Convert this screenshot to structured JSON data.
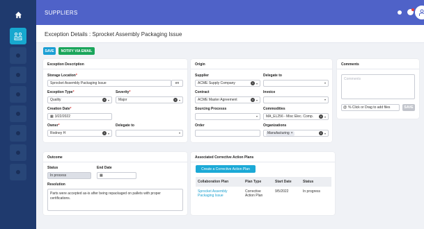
{
  "header": {
    "module_title": "SUPPLIERS"
  },
  "subheader": {
    "page_title": "Exception Details : Sprocket Assembly Packaging Issue"
  },
  "toolbar": {
    "save_label": "SAVE",
    "notify_label": "NOTIFY VIA EMAIL"
  },
  "exception_description": {
    "heading": "Exception Description",
    "storage_location_label": "Storage Location",
    "storage_location_value": "Sprocket Assembly Packaging Issue",
    "language_code": "en",
    "exception_type_label": "Exception Type",
    "exception_type_value": "Quality",
    "severity_label": "Severity",
    "severity_value": "Major",
    "creation_date_label": "Creation Date",
    "creation_date_value": "3/22/2022",
    "owner_label": "Owner",
    "owner_value": "Rodney H",
    "delegate_label": "Delegate to",
    "delegate_value": ""
  },
  "origin": {
    "heading": "Origin",
    "supplier_label": "Supplier",
    "supplier_value": "ACME Supply Company",
    "delegate_label": "Delegate to",
    "delegate_value": "",
    "contract_label": "Contract",
    "contract_value": "ACME Master Agreement",
    "invoice_label": "Invoice",
    "invoice_value": "",
    "sourcing_label": "Sourcing Processs",
    "sourcing_value": "",
    "commodities_label": "Commodities",
    "commodities_value": "MA_EL256 - Misc Elec. Comp.",
    "order_label": "Order",
    "order_value": "",
    "organizations_label": "Organizations",
    "organizations_tag": "Manufacturing"
  },
  "comments": {
    "heading": "Comments",
    "placeholder": "Comments",
    "attach_text": "% Click or Drag to add files",
    "save_label": "SAVE"
  },
  "outcome": {
    "heading": "Outcome",
    "status_label": "Status",
    "status_value": "In process",
    "end_date_label": "End Date",
    "end_date_value": "",
    "resolution_label": "Resolution",
    "resolution_value": "Parts were accepted as-is after being repackaged on pallets with proper certifications."
  },
  "cap": {
    "heading": "Associated Corrective Action Plans",
    "create_button": "Create a Corrective Action Plan",
    "columns": [
      "Collaboration Plan",
      "Plan Type",
      "Start Date",
      "Status"
    ],
    "rows": [
      {
        "plan": "Sprocket Assembly Packaging Issue",
        "type": "Corrective Action Plan",
        "start": "9/5/2022",
        "status": "In progress"
      }
    ]
  },
  "colors": {
    "rail": "#1f3a6e",
    "topbar": "#4f62c8",
    "accent": "#1a9fd4",
    "notify": "#1aa55b"
  }
}
